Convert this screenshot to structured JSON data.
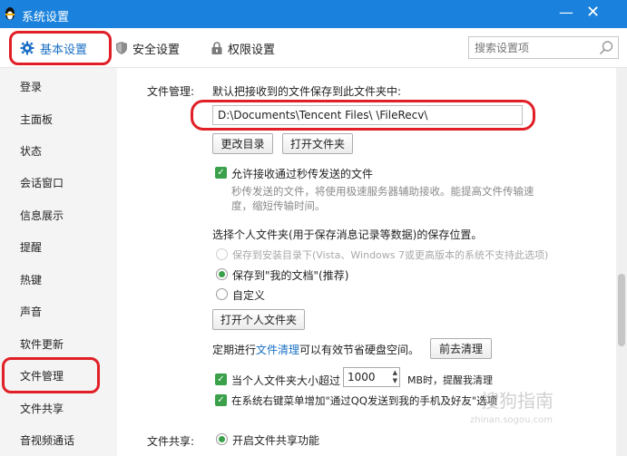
{
  "window": {
    "title": "系统设置",
    "minimize": "—",
    "close": "✕"
  },
  "tabs": [
    {
      "label": "基本设置",
      "icon": "gear-icon"
    },
    {
      "label": "安全设置",
      "icon": "shield-icon"
    },
    {
      "label": "权限设置",
      "icon": "lock-icon"
    }
  ],
  "search": {
    "placeholder": "搜索设置项"
  },
  "sidebar": {
    "items": [
      "登录",
      "主面板",
      "状态",
      "会话窗口",
      "信息展示",
      "提醒",
      "热键",
      "声音",
      "软件更新",
      "文件管理",
      "文件共享",
      "音视频通话"
    ],
    "selected": "文件管理"
  },
  "file_mgmt": {
    "section_label": "文件管理:",
    "save_desc": "默认把接收到的文件保存到此文件夹中:",
    "path_value": "D:\\Documents\\Tencent Files\\              \\FileRecv\\",
    "change_dir_button": "更改目录",
    "open_folder_button": "打开文件夹",
    "allow_flash_checkbox": "允许接收通过秒传发送的文件",
    "allow_flash_desc_1": "秒传发送的文件，将使用极速服务器辅助接收。能提高文件传输速",
    "allow_flash_desc_2": "度，缩短传输时间。",
    "personal_folder_desc": "选择个人文件夹(用于保存消息记录等数据)的保存位置。",
    "radio_install_dir": "保存到安装目录下(Vista、Windows 7或更高版本的系统不支持此选项)",
    "radio_my_docs": "保存到\"我的文档\"(推荐)",
    "radio_custom": "自定义",
    "open_personal_folder_button": "打开个人文件夹",
    "cleanup_prefix": "定期进行",
    "cleanup_link": "文件清理",
    "cleanup_suffix": "可以有效节省硬盘空间。",
    "cleanup_button": "前去清理",
    "size_alert_prefix": "当个人文件夹大小超过",
    "size_alert_value": "1000",
    "size_alert_suffix": "MB时，提醒我清理",
    "context_menu_checkbox": "在系统右键菜单增加\"通过QQ发送到我的手机及好友\"选项"
  },
  "file_share": {
    "section_label": "文件共享:",
    "enable_radio": "开启文件共享功能"
  },
  "watermark": {
    "main": "搜狗指南",
    "sub": "zhinan.sogou.com"
  }
}
